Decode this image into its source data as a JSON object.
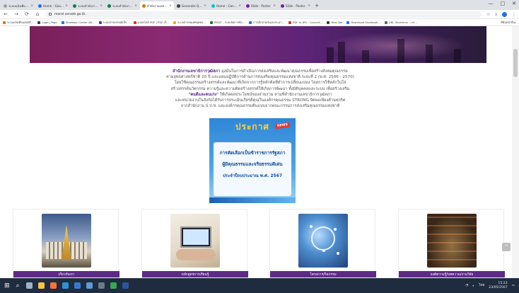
{
  "browser": {
    "tabs": [
      {
        "title": "ระบบแจ้งเตือนสมบัติ...",
        "color": "#9aa0a6",
        "active": false
      },
      {
        "title": "Home - Google Drive",
        "color": "#1a73e8",
        "active": false
      },
      {
        "title": "ระบบสำนักงานอิเล็กฯ...",
        "color": "#0b8043",
        "active": false
      },
      {
        "title": "ระบบสำนักงานอิเล็กฯ...",
        "color": "#0b8043",
        "active": false
      },
      {
        "title": "สำนักงานเลขาธิการวุฒิ...",
        "color": "#e37400",
        "active": true
      },
      {
        "title": "Generate QR code",
        "color": "#3c4043",
        "active": false
      },
      {
        "title": "Home - Canva",
        "color": "#00c4cc",
        "active": false
      },
      {
        "title": "Slide - Poster",
        "color": "#7b1fa2",
        "active": false
      },
      {
        "title": "Slide - Poster",
        "color": "#7b1fa2",
        "active": false
      }
    ],
    "new_tab": "+",
    "window_controls": [
      "—",
      "□",
      "✕"
    ],
    "url": "moral.senate.go.th",
    "bookmarks": [
      {
        "label": "ระบบแจ้งเตือนสมบัติ...",
        "color": "#e37400"
      },
      {
        "label": "Login_Page",
        "color": "#3c4043"
      },
      {
        "label": "Strategic Center อค...",
        "color": "#1a73e8"
      },
      {
        "label": "ระบบสารบรรณอิเล็ก...",
        "color": "#5e35b1"
      },
      {
        "label": "แปลงไฟล์ PDF | PDF เป็...",
        "color": "#d93025"
      },
      {
        "label": "ระบบสารสนเทศบุคคล...",
        "color": "#f9ab00"
      },
      {
        "label": "PMQT - ระบบจัดการข้อ...",
        "color": "#0b8043"
      },
      {
        "label": "การเบิกจ่ายเงินงบประมา...",
        "color": "#1a73e8"
      },
      {
        "label": "PDF to JPG - Convert...",
        "color": "#d93025"
      },
      {
        "label": "New Tab",
        "color": "#3c4043"
      },
      {
        "label": "Download Facebook...",
        "color": "#1877f2"
      },
      {
        "label": "URL Shortener - url...",
        "color": "#5f6368"
      }
    ],
    "bookmarks_right": "ที่คั่นหน้าอื่นๆ"
  },
  "page": {
    "intro_org": "สำนักงานเลขาธิการวุฒิสภา",
    "intro_line1": " มุ่งมั่นในการดำเนินการส่งเสริมและพัฒนาคุณธรรมเพื่อสร้างสังคมคุณธรรม",
    "intro_line2": "ตามยุทธศาสตร์ชาติ 20 ปี และแผนปฏิบัติการด้านการส่งเสริมคุณธรรมแห่งชาติ ระยะที่ 2 (พ.ศ. 2566 - 2570)",
    "intro_line3": "โดยใช้คุณธรรมสร้างสรรค์และพัฒนาที่เกิดจากการรู้หลักคิดที่ทำการเปลี่ยนแปลง โดยการใช้หลักในใส่",
    "intro_line4": "สร้างสรรค์นวัตกรรม ความรู้และความคิดสร้างสรรค์ให้เกิดการพัฒนา ทั้งมิติบุคคลและระบบ เพื่อสร้างเสริม",
    "intro_highlight": "\"คนดีและคนเก่ง\"",
    "intro_line5": " ให้เกิดผลประโยชน์ของส่วนรวม ตามที่สำนักงานเลขาธิการวุฒิสภา",
    "intro_line6": "และหน่วยงานในสังกัดได้รับการประเมินเกียรติคุณในองค์กรคุณธรรม STRONG จิตพอเพียงต้านทุจริต",
    "intro_line7": "จากสำนักงาน ป.ป.ช. และองค์กรคุณธรรมต้นแบบจากคณะกรรมการส่งเสริมคุณธรรมแห่งชาติ",
    "banner": {
      "heading": "ประกาศ",
      "badge": "NEWS",
      "line1": "การคัดเลือกเป็นข้าราชการรัฐสภา",
      "line2": "ผู้มีคุณธรรมและจริยธรรมดีเด่น",
      "line3": "ประจำปีงบประมาณ พ.ศ. 2567"
    },
    "cards": [
      {
        "label": "เกี่ยวกับเรา"
      },
      {
        "label": "หลักสูตรการเรียนรู้"
      },
      {
        "label": "โครงการ/กิจกรรม"
      },
      {
        "label": "องค์ความรู้/บทความ/งานวิจัย"
      }
    ],
    "scroll_top_button": "^"
  },
  "taskbar": {
    "start": "⊞",
    "search": "⌕",
    "apps": [
      {
        "name": "task-view",
        "color": "#9fb3c8"
      },
      {
        "name": "file-explorer",
        "color": "#f5c542"
      },
      {
        "name": "firefox",
        "color": "#ff7139"
      },
      {
        "name": "edge",
        "color": "#2f8fd8"
      },
      {
        "name": "mail",
        "color": "#3a78d4"
      },
      {
        "name": "store",
        "color": "#5a9bd5"
      },
      {
        "name": "camera",
        "color": "#6d7a8a"
      },
      {
        "name": "chrome",
        "color": "#34a853"
      },
      {
        "name": "word",
        "color": "#2b579a"
      }
    ],
    "time": "15:23",
    "date": "23/05/2567",
    "lang": "ไทย"
  }
}
